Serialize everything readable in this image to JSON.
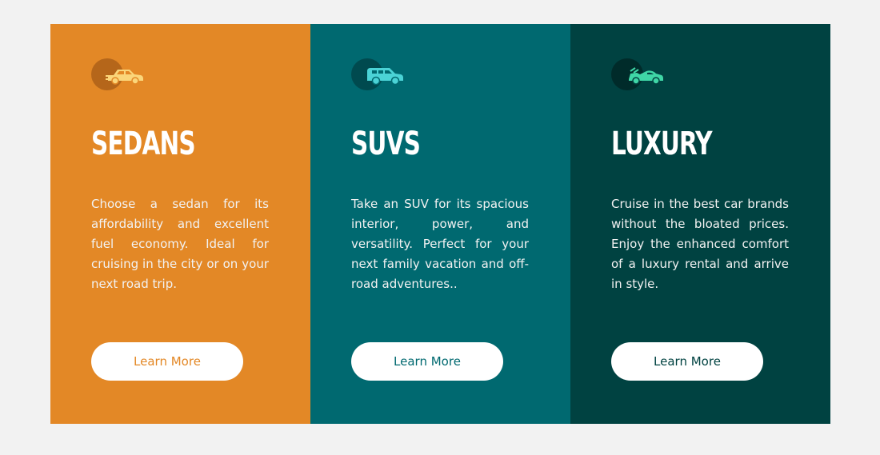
{
  "colors": {
    "page_background": "#f2f2f2",
    "sedans": "#e38826",
    "suvs": "#006970",
    "luxury": "#004241",
    "button_background": "#ffffff"
  },
  "cards": [
    {
      "key": "sedans",
      "icon": "sedan-car-icon",
      "title": "Sedans",
      "text": "Choose a sedan for its affordability and excellent fuel economy. Ideal for cruising in the city or on your next road trip.",
      "button_label": "Learn More"
    },
    {
      "key": "suvs",
      "icon": "suv-car-icon",
      "title": "SUVs",
      "text": "Take an SUV for its spacious interior, power, and versatility. Perfect for your next family vacation and off-road adventures..",
      "button_label": "Learn More"
    },
    {
      "key": "luxury",
      "icon": "convertible-car-icon",
      "title": "Luxury",
      "text": "Cruise in the best car brands without the bloated prices. Enjoy the enhanced comfort of a luxury rental and arrive in style.",
      "button_label": "Learn More"
    }
  ]
}
